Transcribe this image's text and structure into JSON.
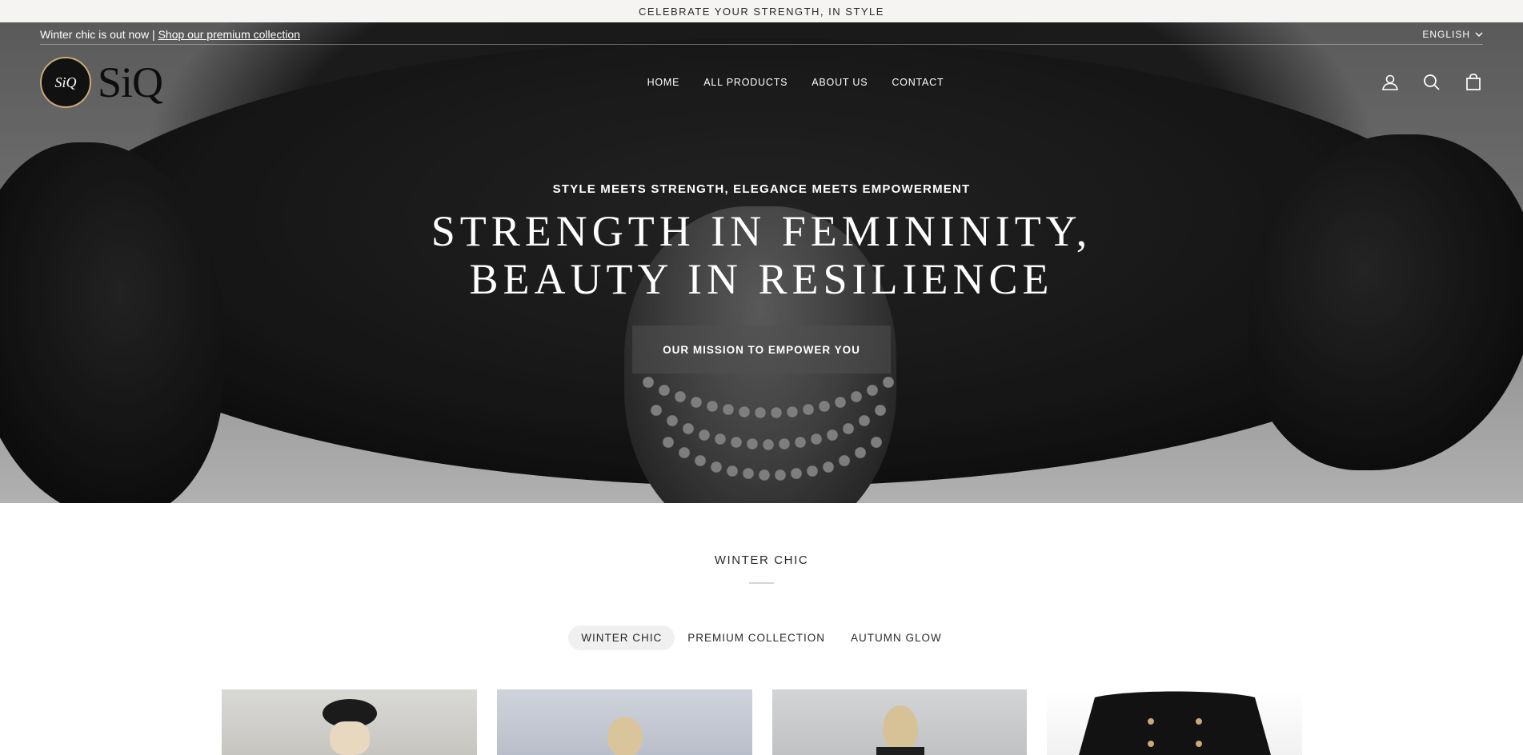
{
  "announcement": {
    "text": "CELEBRATE YOUR STRENGTH, IN STYLE"
  },
  "utility": {
    "promo_text": "Winter chic is out now |",
    "promo_link": "Shop our premium collection",
    "language": "ENGLISH"
  },
  "header": {
    "logo_badge": "SiQ",
    "logo_word": "SiQ",
    "nav": [
      "HOME",
      "ALL PRODUCTS",
      "ABOUT US",
      "CONTACT"
    ],
    "icons": [
      "account-icon",
      "search-icon",
      "cart-icon"
    ]
  },
  "hero": {
    "eyebrow": "STYLE MEETS STRENGTH, ELEGANCE MEETS EMPOWERMENT",
    "title_line1": "STRENGTH IN FEMININITY,",
    "title_line2": "BEAUTY IN RESILIENCE",
    "button": "OUR MISSION TO EMPOWER YOU"
  },
  "collection": {
    "title": "WINTER CHIC",
    "tabs": [
      "WINTER CHIC",
      "PREMIUM COLLECTION",
      "AUTUMN GLOW"
    ],
    "active_tab": 0,
    "products_visible": 4
  },
  "colors": {
    "announcement_bg": "#f5f4f2",
    "accent_gold": "#c9a977",
    "text_dark": "#1a1a1a"
  }
}
